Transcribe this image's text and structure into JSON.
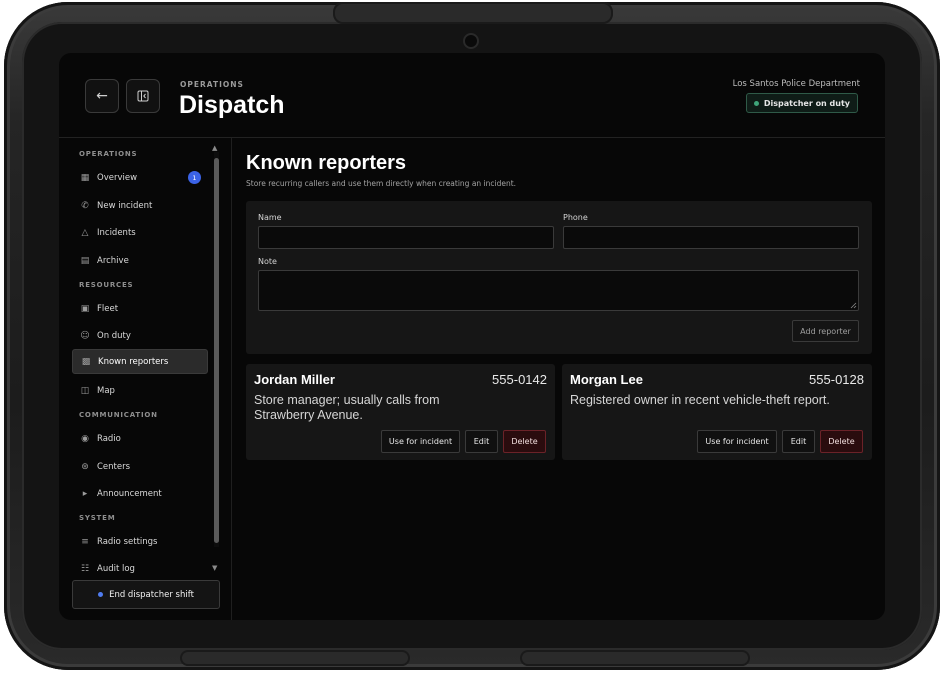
{
  "header": {
    "kicker": "OPERATIONS",
    "title": "Dispatch",
    "org": "Los Santos Police Department",
    "status": "Dispatcher on duty",
    "status_color": "#3fa57a"
  },
  "sidebar": {
    "sections": {
      "operations": "OPERATIONS",
      "resources": "RESOURCES",
      "communication": "COMMUNICATION",
      "system": "SYSTEM"
    },
    "items": [
      {
        "label": "Overview",
        "icon": "grid-icon",
        "badge": "1"
      },
      {
        "label": "New incident",
        "icon": "phone-icon"
      },
      {
        "label": "Incidents",
        "icon": "siren-icon"
      },
      {
        "label": "Archive",
        "icon": "archive-icon"
      },
      {
        "label": "Fleet",
        "icon": "truck-icon"
      },
      {
        "label": "On duty",
        "icon": "users-icon"
      },
      {
        "label": "Known reporters",
        "icon": "contact-icon",
        "active": true
      },
      {
        "label": "Map",
        "icon": "map-icon"
      },
      {
        "label": "Radio",
        "icon": "radio-icon"
      },
      {
        "label": "Centers",
        "icon": "tower-icon"
      },
      {
        "label": "Announcement",
        "icon": "megaphone-icon"
      },
      {
        "label": "Radio settings",
        "icon": "sliders-icon"
      },
      {
        "label": "Audit log",
        "icon": "log-icon"
      }
    ],
    "end_shift": "End dispatcher shift",
    "end_shift_dot": "#4f7cf0"
  },
  "main": {
    "title": "Known reporters",
    "subtitle": "Store recurring callers and use them directly when creating an incident.",
    "form": {
      "name_label": "Name",
      "name_value": "",
      "phone_label": "Phone",
      "phone_value": "",
      "note_label": "Note",
      "note_value": "",
      "add_button": "Add reporter"
    },
    "reporters": [
      {
        "name": "Jordan Miller",
        "phone": "555-0142",
        "note": "Store manager; usually calls from Strawberry Avenue.",
        "use": "Use for incident",
        "edit": "Edit",
        "delete": "Delete"
      },
      {
        "name": "Morgan Lee",
        "phone": "555-0128",
        "note": "Registered owner in recent vehicle-theft report.",
        "use": "Use for incident",
        "edit": "Edit",
        "delete": "Delete"
      }
    ]
  }
}
